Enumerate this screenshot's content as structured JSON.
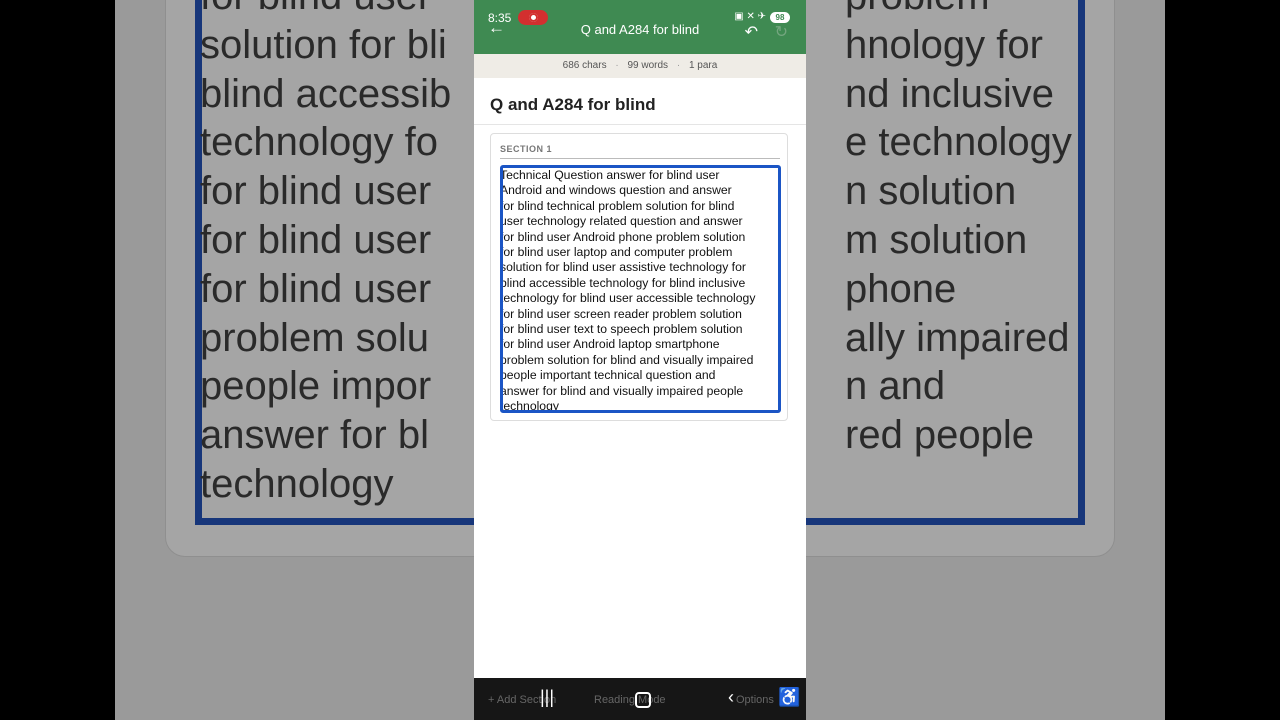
{
  "background_text": [
    "for blind user",
    "solution for bli",
    "blind accessib",
    "technology fo",
    "for blind user",
    "for blind user",
    "for blind user",
    "problem solu",
    "people impor",
    "answer for bl",
    "technology"
  ],
  "background_text_right": [
    "problem",
    "hnology for",
    "nd inclusive",
    "e technology",
    "n solution",
    "m solution",
    "phone",
    "ally impaired",
    "n and",
    "red people",
    ""
  ],
  "status_bar": {
    "time": "8:35",
    "battery": "98"
  },
  "toolbar": {
    "title": "Q and A284 for blind",
    "back_icon": "arrow-left-icon",
    "undo_icon": "undo-icon",
    "redo_icon": "redo-icon"
  },
  "stats": {
    "chars": "686 chars",
    "words": "99 words",
    "paras": "1 para"
  },
  "document": {
    "title": "Q and A284 for blind"
  },
  "section": {
    "label": "SECTION 1",
    "lines": [
      "Technical Question answer for blind user",
      "Android and windows question and answer",
      "for blind technical problem solution for blind",
      "user technology related question and answer",
      "for blind user Android phone problem solution",
      "for blind user laptop and computer problem",
      "solution for blind user assistive technology for",
      "blind accessible  technology for blind inclusive",
      "technology for blind user accessible technology",
      "for blind user screen reader problem solution",
      "for blind user text to speech problem solution",
      "for blind user Android laptop smartphone",
      "problem solution for blind and visually impaired",
      "people important technical question and",
      "answer for blind and visually impaired people",
      "technology"
    ]
  },
  "bottom_bar": {
    "add_section": "+ Add Section",
    "reading_mode": "Reading Mode",
    "options": "Options"
  },
  "colors": {
    "toolbar": "#3f8a52",
    "editor_border": "#1b55c5",
    "record": "#d32f2f"
  }
}
